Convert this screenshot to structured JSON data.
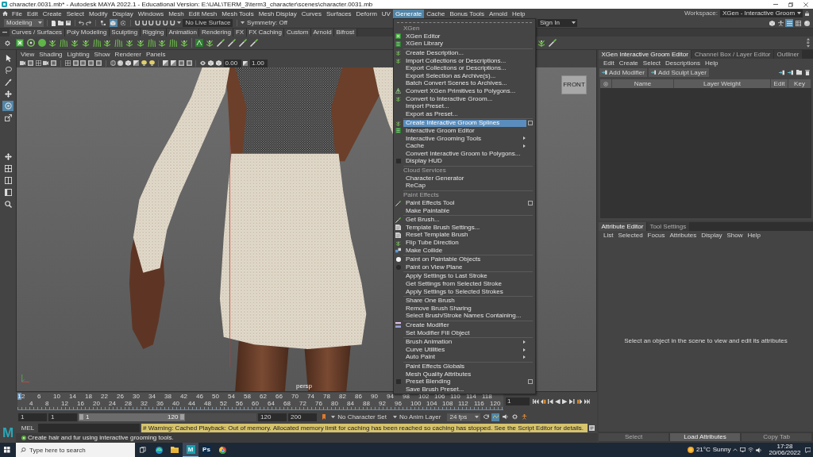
{
  "window": {
    "title": "character.0031.mb* - Autodesk MAYA 2022.1 - Educational Version: E:\\UAL\\TERM_3\\term3_character\\scenes\\character.0031.mb"
  },
  "menu_bar": {
    "items": [
      {
        "label": "File",
        "selected": false
      },
      {
        "label": "Edit",
        "selected": false
      },
      {
        "label": "Create",
        "selected": false
      },
      {
        "label": "Select",
        "selected": false
      },
      {
        "label": "Modify",
        "selected": false
      },
      {
        "label": "Display",
        "selected": false
      },
      {
        "label": "Windows",
        "selected": false
      },
      {
        "label": "Mesh",
        "selected": false
      },
      {
        "label": "Edit Mesh",
        "selected": false
      },
      {
        "label": "Mesh Tools",
        "selected": false
      },
      {
        "label": "Mesh Display",
        "selected": false
      },
      {
        "label": "Curves",
        "selected": false
      },
      {
        "label": "Surfaces",
        "selected": false
      },
      {
        "label": "Deform",
        "selected": false
      },
      {
        "label": "UV",
        "selected": false
      },
      {
        "label": "Generate",
        "selected": true
      },
      {
        "label": "Cache",
        "selected": false
      },
      {
        "label": "Bonus Tools",
        "selected": false
      },
      {
        "label": "Arnold",
        "selected": false
      },
      {
        "label": "Help",
        "selected": false
      }
    ],
    "workspace_label": "Workspace:",
    "workspace": "XGen - Interactive Groom"
  },
  "status_line": {
    "mode": "Modeling",
    "select_modes": [
      {
        "selected": false
      },
      {
        "selected": true
      },
      {
        "selected": false
      }
    ],
    "live_surface": "No Live Surface",
    "symmetry": "Symmetry: Off",
    "sign_in": "Sign In",
    "panel_toggles": [
      {
        "selected": false
      },
      {
        "selected": false
      },
      {
        "selected": true
      },
      {
        "selected": false
      },
      {
        "selected": false
      }
    ]
  },
  "shelf": {
    "tabs": [
      {
        "label": "Curves / Surfaces",
        "selected": false
      },
      {
        "label": "Poly Modeling",
        "selected": false
      },
      {
        "label": "Sculpting",
        "selected": false
      },
      {
        "label": "Rigging",
        "selected": false
      },
      {
        "label": "Animation",
        "selected": false
      },
      {
        "label": "Rendering",
        "selected": false
      },
      {
        "label": "FX",
        "selected": false
      },
      {
        "label": "FX Caching",
        "selected": false
      },
      {
        "label": "Custom",
        "selected": false
      },
      {
        "label": "Arnold",
        "selected": false
      },
      {
        "label": "Bifrost",
        "selected": false
      }
    ]
  },
  "toolbox": {
    "tools": [
      {
        "selected": false
      },
      {
        "selected": false
      },
      {
        "selected": false
      },
      {
        "selected": false
      },
      {
        "selected": true
      },
      {
        "selected": false
      }
    ]
  },
  "viewport": {
    "menu": [
      "View",
      "Shading",
      "Lighting",
      "Show",
      "Renderer",
      "Panels"
    ],
    "exposure": "0.00",
    "gamma": "1.00",
    "view_cube": "FRONT",
    "camera": "persp"
  },
  "generate_menu": {
    "sections": [
      {
        "title": "XGen",
        "groups": [
          [
            {
              "label": "XGen Editor",
              "kind": "action",
              "selected": false
            },
            {
              "label": "XGen Library",
              "kind": "action",
              "selected": false
            }
          ],
          [
            {
              "label": "Create Description...",
              "kind": "action",
              "selected": false
            },
            {
              "label": "Import Collections or Descriptions...",
              "kind": "action",
              "selected": false
            },
            {
              "label": "Export Collections or Descriptions...",
              "kind": "action",
              "selected": false
            },
            {
              "label": "Export Selection as Archive(s)...",
              "kind": "action",
              "selected": false
            },
            {
              "label": "Batch Convert Scenes to Archives...",
              "kind": "action",
              "selected": false
            },
            {
              "label": "Convert XGen Primitives to Polygons...",
              "kind": "action",
              "selected": false
            },
            {
              "label": "Convert to Interactive Groom...",
              "kind": "action",
              "selected": false
            },
            {
              "label": "Import Preset...",
              "kind": "action",
              "selected": false
            },
            {
              "label": "Export as Preset...",
              "kind": "action",
              "selected": false
            }
          ],
          [
            {
              "label": "Create Interactive Groom Splines",
              "kind": "action",
              "selected": true,
              "option_box": true
            },
            {
              "label": "Interactive Groom Editor",
              "kind": "action",
              "selected": false
            },
            {
              "label": "Interactive Grooming Tools",
              "kind": "submenu",
              "selected": false
            },
            {
              "label": "Cache",
              "kind": "submenu",
              "selected": false
            },
            {
              "label": "Convert Interactive Groom to Polygons...",
              "kind": "action",
              "selected": false
            },
            {
              "label": "Display HUD",
              "kind": "toggle",
              "checked": false,
              "selected": false
            }
          ]
        ]
      },
      {
        "title": "Cloud Services",
        "groups": [
          [
            {
              "label": "Character Generator",
              "kind": "action",
              "selected": false
            },
            {
              "label": "ReCap",
              "kind": "action",
              "selected": false
            }
          ]
        ]
      },
      {
        "title": "Paint Effects",
        "groups": [
          [
            {
              "label": "Paint Effects Tool",
              "kind": "action",
              "selected": false,
              "option_box": true
            },
            {
              "label": "Make Paintable",
              "kind": "action",
              "selected": false
            }
          ],
          [
            {
              "label": "Get Brush...",
              "kind": "action",
              "selected": false
            },
            {
              "label": "Template Brush Settings...",
              "kind": "action",
              "selected": false
            },
            {
              "label": "Reset Template Brush",
              "kind": "action",
              "selected": false
            },
            {
              "label": "Flip Tube Direction",
              "kind": "action",
              "selected": false
            },
            {
              "label": "Make Collide",
              "kind": "action",
              "selected": false
            }
          ],
          [
            {
              "label": "Paint on Paintable Objects",
              "kind": "radio",
              "checked": true,
              "selected": false
            },
            {
              "label": "Paint on View Plane",
              "kind": "radio",
              "checked": false,
              "selected": false
            }
          ],
          [
            {
              "label": "Apply Settings to Last Stroke",
              "kind": "action",
              "selected": false
            },
            {
              "label": "Get Settings from Selected Stroke",
              "kind": "action",
              "selected": false
            },
            {
              "label": "Apply Settings to Selected Strokes",
              "kind": "action",
              "selected": false
            }
          ],
          [
            {
              "label": "Share One Brush",
              "kind": "action",
              "selected": false
            },
            {
              "label": "Remove Brush Sharing",
              "kind": "action",
              "selected": false
            },
            {
              "label": "Select Brush/Stroke Names Containing...",
              "kind": "action",
              "selected": false
            }
          ],
          [
            {
              "label": "Create Modifier",
              "kind": "action",
              "selected": false
            },
            {
              "label": "Set Modifier Fill Object",
              "kind": "action",
              "selected": false
            }
          ],
          [
            {
              "label": "Brush Animation",
              "kind": "submenu",
              "selected": false
            },
            {
              "label": "Curve Utilities",
              "kind": "submenu",
              "selected": false
            },
            {
              "label": "Auto Paint",
              "kind": "submenu",
              "selected": false
            }
          ],
          [
            {
              "label": "Paint Effects Globals",
              "kind": "action",
              "selected": false
            },
            {
              "label": "Mesh Quality Attributes",
              "kind": "action",
              "selected": false
            },
            {
              "label": "Preset Blending",
              "kind": "toggle",
              "checked": false,
              "selected": false,
              "option_box": true
            },
            {
              "label": "Save Brush Preset...",
              "kind": "action",
              "selected": false
            }
          ]
        ]
      }
    ]
  },
  "groom_editor": {
    "tabs": [
      {
        "label": "XGen Interactive Groom Editor",
        "selected": true
      },
      {
        "label": "Channel Box / Layer Editor",
        "selected": false
      },
      {
        "label": "Outliner",
        "selected": false
      }
    ],
    "menu": [
      "Edit",
      "Create",
      "Select",
      "Descriptions",
      "Help"
    ],
    "buttons": [
      "Add Modifier",
      "Add Sculpt Layer"
    ],
    "columns": [
      "Name",
      "Layer Weight",
      "Edit",
      "Key"
    ]
  },
  "attribute_editor": {
    "tabs": [
      {
        "label": "Attribute Editor",
        "selected": true
      },
      {
        "label": "Tool Settings",
        "selected": false
      }
    ],
    "menu": [
      "List",
      "Selected",
      "Focus",
      "Attributes",
      "Display",
      "Show",
      "Help"
    ],
    "message": "Select an object in the scene to view and edit its attributes",
    "buttons": [
      {
        "label": "Select",
        "disabled": true
      },
      {
        "label": "Load Attributes",
        "disabled": false
      },
      {
        "label": "Copy Tab",
        "disabled": true
      }
    ]
  },
  "time_slider": {
    "marker": "1",
    "ticks": [
      "2",
      "4",
      "6",
      "8",
      "10",
      "12",
      "14",
      "16",
      "18",
      "20",
      "22",
      "24",
      "26",
      "28",
      "30",
      "32",
      "34",
      "36",
      "38",
      "40",
      "42",
      "44",
      "46",
      "48",
      "50",
      "52",
      "54",
      "56",
      "58",
      "60",
      "62",
      "64",
      "66",
      "68",
      "70",
      "72",
      "74",
      "76",
      "78",
      "80",
      "82",
      "84",
      "86",
      "88",
      "90",
      "92",
      "94",
      "96",
      "98",
      "100",
      "102",
      "104",
      "106",
      "108",
      "110",
      "112",
      "114",
      "116",
      "118",
      "120"
    ],
    "current_frame": "1"
  },
  "range_slider": {
    "start": "1",
    "playback_start": "1",
    "range_start": "1",
    "range_end": "120",
    "level": 0.6,
    "playback_end": "120",
    "end": "200",
    "character_set": "No Character Set",
    "anim_layer": "No Anim Layer",
    "fps": "24 fps",
    "toggles": [
      {
        "selected": false
      },
      {
        "selected": true
      },
      {
        "selected": false
      },
      {
        "selected": false
      },
      {
        "selected": false
      }
    ]
  },
  "command_line": {
    "language": "MEL",
    "result": "# Warning: Cached Playback: Out of memory. Allocated memory limit for caching has been reached so caching has stopped. See the Script Editor for details."
  },
  "help_line": "Create hair and fur using interactive grooming tools.",
  "logo": "M",
  "taskbar": {
    "search_placeholder": "Type here to search",
    "apps": [
      {
        "kind": "swirl",
        "selected": false
      },
      {
        "kind": "folder",
        "selected": false
      },
      {
        "kind": "tile",
        "label": "M",
        "color": "#1a9fae",
        "selected": true
      },
      {
        "kind": "tile",
        "label": "Ps",
        "color": "#0c2a48",
        "selected": false
      },
      {
        "kind": "ball",
        "selected": false
      }
    ],
    "temperature": "21°C",
    "weather": "Sunny",
    "time": "17:28",
    "date": "20/06/2022"
  }
}
